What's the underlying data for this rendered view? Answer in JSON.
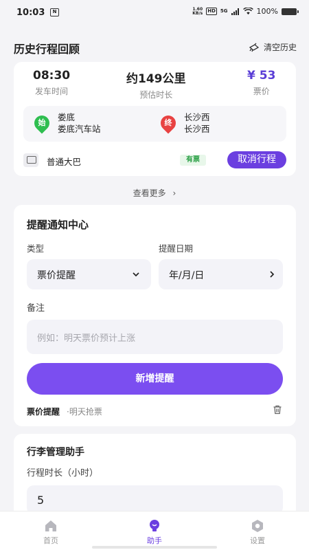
{
  "status_bar": {
    "time": "10:03",
    "net_speed_top": "1.60",
    "net_speed_bottom": "KB/s",
    "hd": "HD",
    "signal_5g": "5G",
    "battery": "100%"
  },
  "history": {
    "title": "历史行程回顾",
    "clear_label": "清空历史",
    "trip": {
      "depart_time": "08:30",
      "depart_label": "发车时间",
      "duration": "约149公里",
      "duration_label": "预估时长",
      "price": "¥ 53",
      "price_label": "票价",
      "start_pin": "始",
      "start_city": "娄底",
      "start_station": "娄底汽车站",
      "end_pin": "终",
      "end_city": "长沙西",
      "end_station": "长沙西",
      "bus_type": "普通大巴",
      "ticket_status": "有票",
      "cancel_label": "取消行程"
    },
    "see_more": "查看更多"
  },
  "reminder": {
    "title": "提醒通知中心",
    "type_label": "类型",
    "type_value": "票价提醒",
    "date_label": "提醒日期",
    "date_value": "年/月/日",
    "note_label": "备注",
    "note_placeholder": "例如：明天票价预计上涨",
    "add_label": "新增提醒",
    "item_type": "票价提醒",
    "item_note": "·明天抢票"
  },
  "luggage": {
    "title": "行李管理助手",
    "duration_label": "行程时长（小时）",
    "duration_value": "5"
  },
  "tabs": [
    {
      "label": "首页",
      "icon": "home-icon"
    },
    {
      "label": "助手",
      "icon": "bulb-icon"
    },
    {
      "label": "设置",
      "icon": "settings-icon"
    }
  ],
  "colors": {
    "accent": "#6b3fe0",
    "start_pin": "#2fbe50",
    "end_pin": "#e84242",
    "price": "#5a3ed6"
  }
}
